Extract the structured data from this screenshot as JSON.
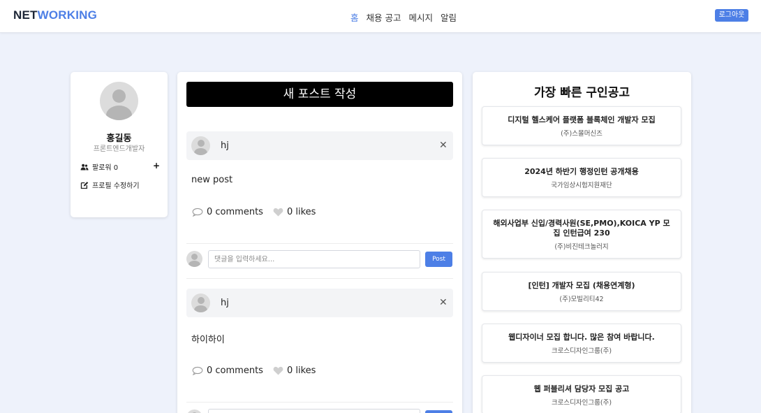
{
  "header": {
    "logo_part1": "NET",
    "logo_part2": "WORKING",
    "nav": [
      "홈",
      "채용 공고",
      "메시지",
      "알림"
    ],
    "active_nav": "홈",
    "logout_label": "로그아웃"
  },
  "profile": {
    "name": "홍길동",
    "role": "프론트엔드개발자",
    "followers_label": "팔로워 0",
    "add_icon": "+",
    "edit_label": "프로필 수정하기"
  },
  "feed": {
    "new_post_label": "새 포스트 작성",
    "comment_placeholder": "댓글을 입력하세요...",
    "post_button_label": "Post",
    "posts": [
      {
        "author": "hj",
        "content": "new post",
        "comments": "0 comments",
        "likes": "0 likes"
      },
      {
        "author": "hj",
        "content": "하이하이",
        "comments": "0 comments",
        "likes": "0 likes"
      }
    ]
  },
  "jobs": {
    "title": "가장 빠른 구인공고",
    "items": [
      {
        "title": "디지털 헬스케어 플랫폼 블록체인 개발자 모집",
        "company": "(주)스몰머신즈"
      },
      {
        "title": "2024년 하반기 행정인턴 공개채용",
        "company": "국가임상시험지원재단"
      },
      {
        "title": "해외사업부 신입/경력사원(SE,PMO),KOICA YP 모집 인턴급여 230",
        "company": "(주)비진테크놀러지"
      },
      {
        "title": "[인턴] 개발자 모집 (채용연계형)",
        "company": "(주)모빌리티42"
      },
      {
        "title": "웹디자이너 모집 합니다. 많은 참여 바랍니다.",
        "company": "크로스디자인그룹(주)"
      },
      {
        "title": "웹 퍼블리셔 담당자 모집 공고",
        "company": "크로스디자인그룹(주)"
      }
    ]
  },
  "colors": {
    "accent": "#4d7fe6",
    "background": "#eef2fb",
    "dark": "#000000"
  }
}
